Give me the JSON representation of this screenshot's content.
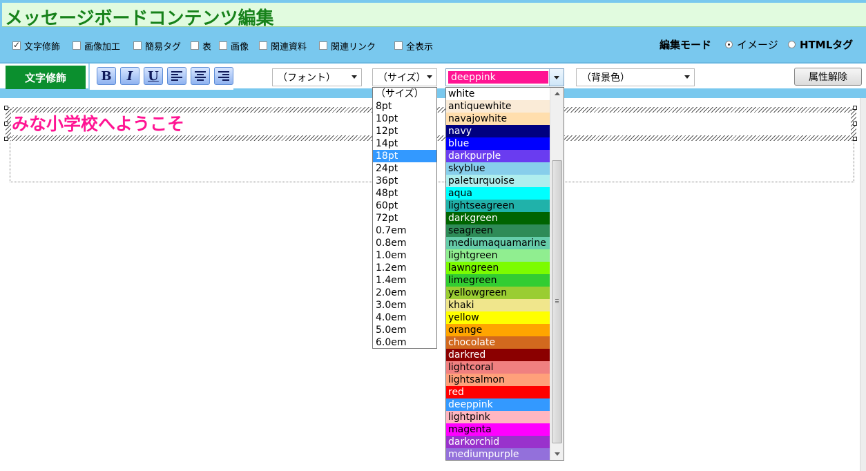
{
  "title": "メッセージボードコンテンツ編集",
  "modes": {
    "checkboxes": [
      {
        "label": "文字修飾",
        "checked": true
      },
      {
        "label": "画像加工",
        "checked": false
      },
      {
        "label": "簡易タグ",
        "checked": false
      },
      {
        "label": "表",
        "checked": false
      },
      {
        "label": "画像",
        "checked": false
      },
      {
        "label": "関連資料",
        "checked": false
      },
      {
        "label": "関連リンク",
        "checked": false
      },
      {
        "label": "全表示",
        "checked": false
      }
    ],
    "edit_mode_label": "編集モード",
    "radio_image": "イメージ",
    "radio_html": "HTMLタグ"
  },
  "toolbar": {
    "section_label": "文字修飾",
    "bold": "B",
    "italic": "I",
    "underline": "U",
    "font_select": "（フォント）",
    "size_select": "（サイズ）",
    "color_select": "deeppink",
    "bgcolor_select": "（背景色）",
    "clear_button": "属性解除"
  },
  "editor": {
    "welcome_text": "みな小学校へようこそ"
  },
  "size_options": [
    "（サイズ）",
    " 8pt",
    "10pt",
    "12pt",
    "14pt",
    "18pt",
    "24pt",
    "36pt",
    "48pt",
    "60pt",
    "72pt",
    "0.7em",
    "0.8em",
    "1.0em",
    "1.2em",
    "1.4em",
    "2.0em",
    "3.0em",
    "4.0em",
    "5.0em",
    "6.0em"
  ],
  "size_selected": "18pt",
  "color_options": [
    {
      "name": "white",
      "bg": "#ffffff",
      "fg": "#000000"
    },
    {
      "name": "antiquewhite",
      "bg": "#faebd7",
      "fg": "#000000"
    },
    {
      "name": "navajowhite",
      "bg": "#ffdead",
      "fg": "#000000"
    },
    {
      "name": "navy",
      "bg": "#000080",
      "fg": "#ffffff"
    },
    {
      "name": "blue",
      "bg": "#0000ff",
      "fg": "#ffffff"
    },
    {
      "name": "darkpurple",
      "bg": "#6a3cf0",
      "fg": "#ffffff"
    },
    {
      "name": "skyblue",
      "bg": "#87ceeb",
      "fg": "#000000"
    },
    {
      "name": "paleturquoise",
      "bg": "#afeeee",
      "fg": "#000000"
    },
    {
      "name": "aqua",
      "bg": "#00ffff",
      "fg": "#000000"
    },
    {
      "name": "lightseagreen",
      "bg": "#20b2aa",
      "fg": "#000000"
    },
    {
      "name": "darkgreen",
      "bg": "#006400",
      "fg": "#ffffff"
    },
    {
      "name": "seagreen",
      "bg": "#2e8b57",
      "fg": "#000000"
    },
    {
      "name": "mediumaquamarine",
      "bg": "#66cdaa",
      "fg": "#000000"
    },
    {
      "name": "lightgreen",
      "bg": "#90ee90",
      "fg": "#000000"
    },
    {
      "name": "lawngreen",
      "bg": "#7cfc00",
      "fg": "#000000"
    },
    {
      "name": "limegreen",
      "bg": "#32cd32",
      "fg": "#000000"
    },
    {
      "name": "yellowgreen",
      "bg": "#9acd32",
      "fg": "#000000"
    },
    {
      "name": "khaki",
      "bg": "#f0e68c",
      "fg": "#000000"
    },
    {
      "name": "yellow",
      "bg": "#ffff00",
      "fg": "#000000"
    },
    {
      "name": "orange",
      "bg": "#ffa500",
      "fg": "#000000"
    },
    {
      "name": "chocolate",
      "bg": "#d2691e",
      "fg": "#ffffff"
    },
    {
      "name": "darkred",
      "bg": "#8b0000",
      "fg": "#ffffff"
    },
    {
      "name": "lightcoral",
      "bg": "#f08080",
      "fg": "#000000"
    },
    {
      "name": "lightsalmon",
      "bg": "#ffa07a",
      "fg": "#000000"
    },
    {
      "name": "red",
      "bg": "#ff0000",
      "fg": "#ffffff"
    },
    {
      "name": "deeppink",
      "bg": "#3399ff",
      "fg": "#ffffff"
    },
    {
      "name": "lightpink",
      "bg": "#ffb6c1",
      "fg": "#000000"
    },
    {
      "name": "magenta",
      "bg": "#ff00ff",
      "fg": "#000000"
    },
    {
      "name": "darkorchid",
      "bg": "#9932cc",
      "fg": "#ffffff"
    },
    {
      "name": "mediumpurple",
      "bg": "#9370db",
      "fg": "#ffffff"
    }
  ],
  "colors": {
    "title_green": "#17821a",
    "accent_pink": "#ff1493",
    "section_green": "#0b8f2e",
    "frame_blue": "#79c8ee",
    "selection_blue": "#3399ff"
  }
}
